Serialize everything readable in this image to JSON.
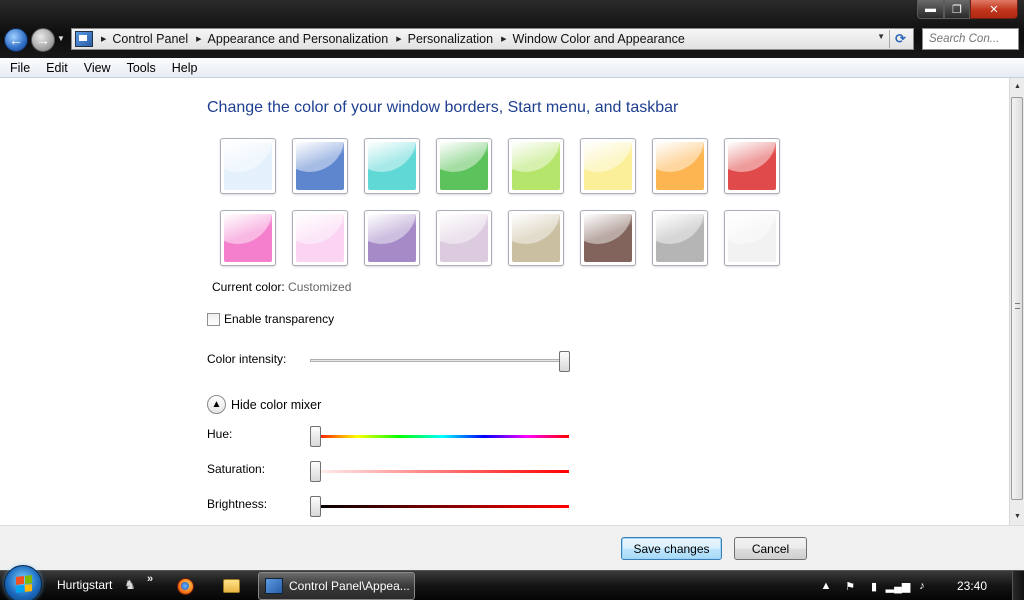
{
  "window": {
    "controls": {
      "minimize": "▬",
      "maximize": "❐",
      "close": "✕"
    }
  },
  "nav": {
    "back_glyph": "←",
    "forward_glyph": "→",
    "breadcrumbs": [
      "Control Panel",
      "Appearance and Personalization",
      "Personalization",
      "Window Color and Appearance"
    ],
    "search_placeholder": "Search Con..."
  },
  "menu": [
    "File",
    "Edit",
    "View",
    "Tools",
    "Help"
  ],
  "main": {
    "title": "Change the color of your window borders, Start menu, and taskbar",
    "swatches": [
      {
        "name": "sky",
        "color": "#e4f1fc"
      },
      {
        "name": "twilight",
        "color": "#5d86cf"
      },
      {
        "name": "sea",
        "color": "#5fd8d6"
      },
      {
        "name": "leaf",
        "color": "#5cc25b"
      },
      {
        "name": "lime",
        "color": "#b5e56b"
      },
      {
        "name": "pumpkin-light",
        "color": "#fbef9a"
      },
      {
        "name": "pumpkin",
        "color": "#fdb552"
      },
      {
        "name": "ruby",
        "color": "#e04a4a"
      },
      {
        "name": "fuchsia",
        "color": "#f47fcd"
      },
      {
        "name": "blush",
        "color": "#fad4f2"
      },
      {
        "name": "violet",
        "color": "#a58ac7"
      },
      {
        "name": "lavender",
        "color": "#dccbde"
      },
      {
        "name": "taupe",
        "color": "#cbbfa2"
      },
      {
        "name": "chocolate",
        "color": "#82645c"
      },
      {
        "name": "slate",
        "color": "#b5b5b5"
      },
      {
        "name": "frost",
        "color": "#f2f2f2"
      }
    ],
    "current_color_label": "Current color:",
    "current_color_value": "Customized",
    "transparency_label": "Enable transparency",
    "transparency_checked": false,
    "intensity_label": "Color intensity:",
    "intensity_level": 1.0,
    "mixer_toggle_label": "Hide color mixer",
    "hue_label": "Hue:",
    "hue_level": 0.0,
    "saturation_label": "Saturation:",
    "saturation_level": 0.0,
    "brightness_label": "Brightness:",
    "brightness_level": 0.0
  },
  "footer": {
    "save_label": "Save changes",
    "cancel_label": "Cancel"
  },
  "taskbar": {
    "quicklaunch_label": "Hurtigstart",
    "more_glyph": "»",
    "task_label": "Control Panel\\Appea...",
    "tray_arrow": "▲",
    "clock": "23:40"
  }
}
